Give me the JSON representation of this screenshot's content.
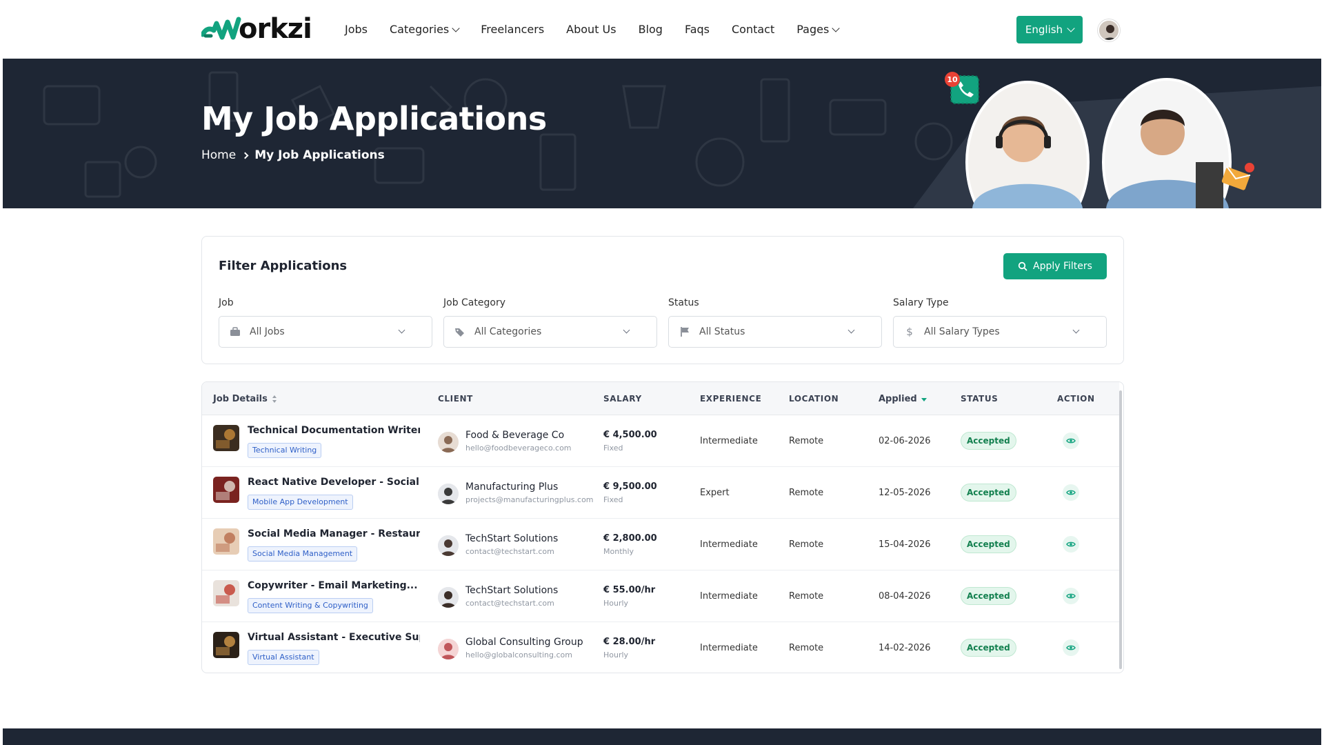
{
  "header": {
    "logo_text": "orkzi",
    "nav": [
      {
        "label": "Jobs",
        "dropdown": false
      },
      {
        "label": "Categories",
        "dropdown": true
      },
      {
        "label": "Freelancers",
        "dropdown": false
      },
      {
        "label": "About Us",
        "dropdown": false
      },
      {
        "label": "Blog",
        "dropdown": false
      },
      {
        "label": "Faqs",
        "dropdown": false
      },
      {
        "label": "Contact",
        "dropdown": false
      },
      {
        "label": "Pages",
        "dropdown": true
      }
    ],
    "language": "English",
    "brand_color": "#12a37f"
  },
  "hero": {
    "title": "My Job Applications",
    "breadcrumb_home": "Home",
    "breadcrumb_current": "My Job Applications",
    "notification_count": "10"
  },
  "filters": {
    "title": "Filter Applications",
    "apply_label": "Apply Filters",
    "fields": [
      {
        "label": "Job",
        "value": "All Jobs",
        "icon": "briefcase-icon"
      },
      {
        "label": "Job Category",
        "value": "All Categories",
        "icon": "tags-icon"
      },
      {
        "label": "Status",
        "value": "All Status",
        "icon": "flag-icon"
      },
      {
        "label": "Salary Type",
        "value": "All Salary Types",
        "icon": "dollar-icon"
      }
    ]
  },
  "table": {
    "columns": {
      "job_details": "Job Details",
      "client": "CLIENT",
      "salary": "SALARY",
      "experience": "EXPERIENCE",
      "location": "LOCATION",
      "applied": "Applied",
      "status": "STATUS",
      "action": "ACTION"
    },
    "rows": [
      {
        "title": "Technical Documentation Writer -...",
        "tag": "Technical Writing",
        "client": "Food & Beverage Co",
        "email": "hello@foodbeverageco.com",
        "salary": "€ 4,500.00",
        "salary_type": "Fixed",
        "experience": "Intermediate",
        "location": "Remote",
        "applied": "02-06-2026",
        "status": "Accepted"
      },
      {
        "title": "React Native Developer - Social...",
        "tag": "Mobile App Development",
        "client": "Manufacturing Plus",
        "email": "projects@manufacturingplus.com",
        "salary": "€ 9,500.00",
        "salary_type": "Fixed",
        "experience": "Expert",
        "location": "Remote",
        "applied": "12-05-2026",
        "status": "Accepted"
      },
      {
        "title": "Social Media Manager - Restaurant...",
        "tag": "Social Media Management",
        "client": "TechStart Solutions",
        "email": "contact@techstart.com",
        "salary": "€ 2,800.00",
        "salary_type": "Monthly",
        "experience": "Intermediate",
        "location": "Remote",
        "applied": "15-04-2026",
        "status": "Accepted"
      },
      {
        "title": "Copywriter - Email Marketing...",
        "tag": "Content Writing & Copywriting",
        "client": "TechStart Solutions",
        "email": "contact@techstart.com",
        "salary": "€ 55.00/hr",
        "salary_type": "Hourly",
        "experience": "Intermediate",
        "location": "Remote",
        "applied": "08-04-2026",
        "status": "Accepted"
      },
      {
        "title": "Virtual Assistant - Executive Support",
        "tag": "Virtual Assistant",
        "client": "Global Consulting Group",
        "email": "hello@globalconsulting.com",
        "salary": "€ 28.00/hr",
        "salary_type": "Hourly",
        "experience": "Intermediate",
        "location": "Remote",
        "applied": "14-02-2026",
        "status": "Accepted"
      }
    ]
  }
}
